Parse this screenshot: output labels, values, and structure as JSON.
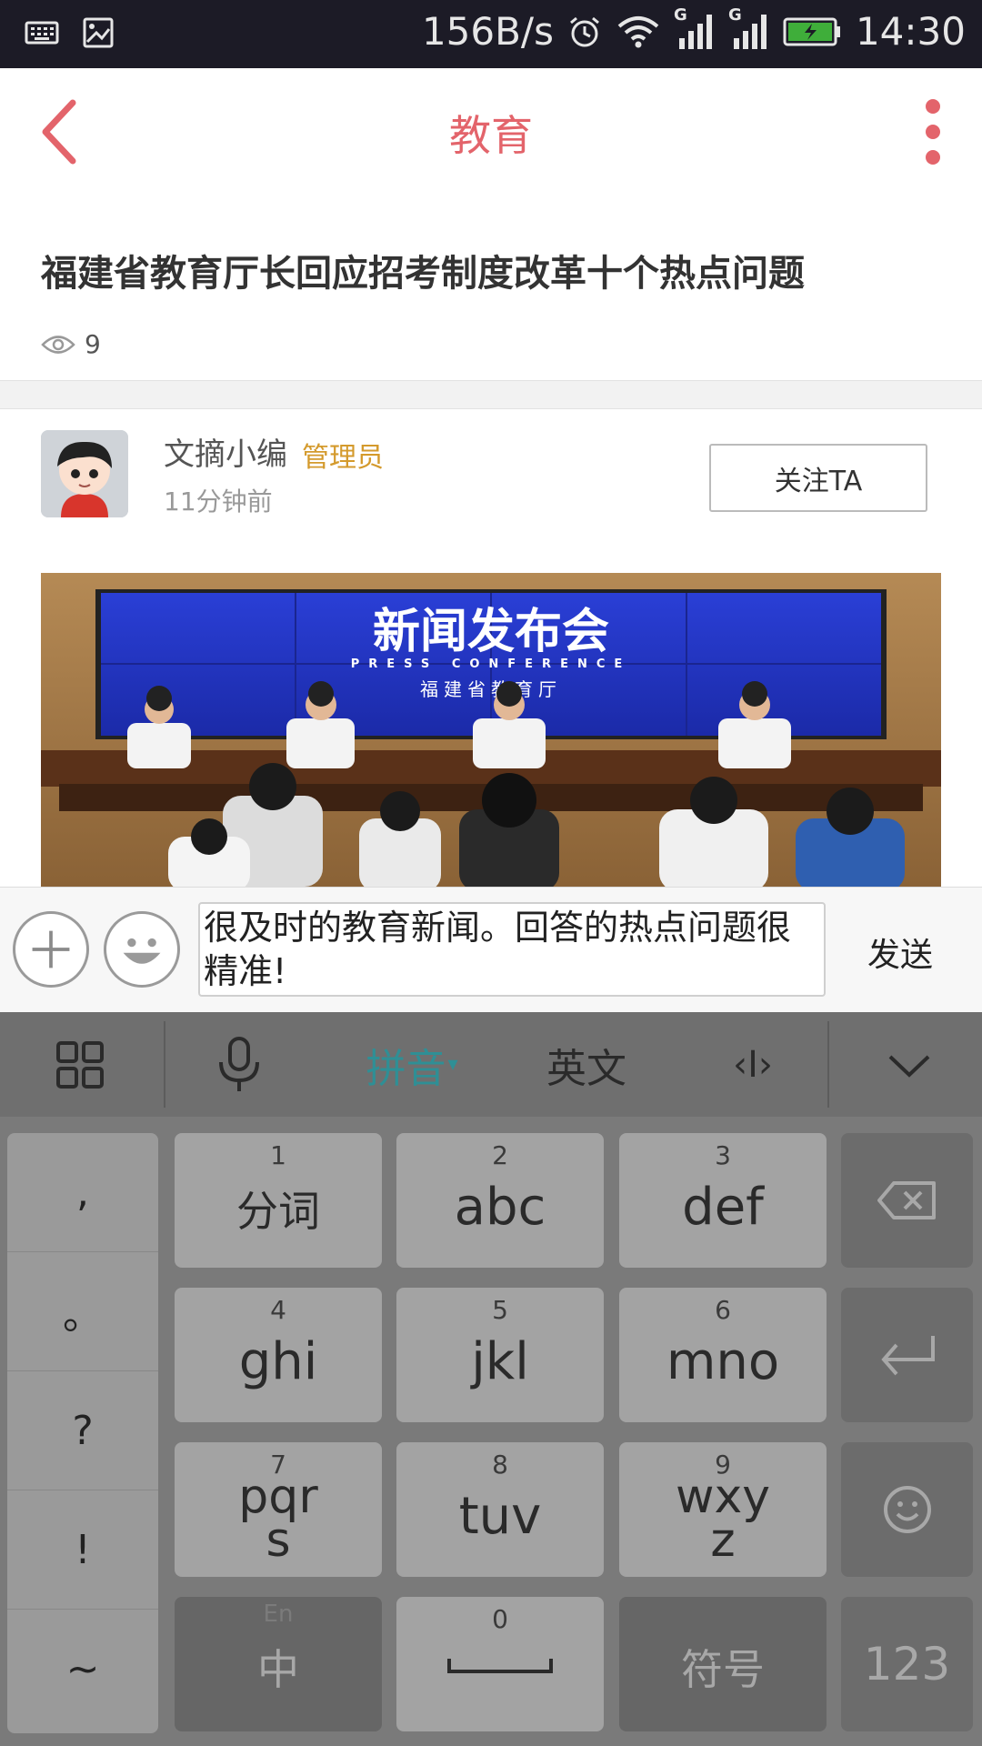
{
  "status_bar": {
    "left_icons": [
      "keyboard-icon",
      "image-icon"
    ],
    "speed": "156B/s",
    "right_icons": [
      "alarm-icon",
      "wifi-icon",
      "signal-icon",
      "signal-icon",
      "battery-charging-icon"
    ],
    "network_badge_1": "G",
    "network_badge_2": "G",
    "time": "14:30"
  },
  "header": {
    "title": "教育",
    "back_icon": "back-arrow-icon",
    "more_icon": "more-vertical-icon",
    "accent_color": "#e3646b"
  },
  "article": {
    "title": "福建省教育厅长回应招考制度改革十个热点问题",
    "view_count": "9",
    "views_icon": "eye-icon"
  },
  "author": {
    "name": "文摘小编",
    "role": "管理员",
    "time": "11分钟前",
    "follow_label": "关注TA"
  },
  "photo": {
    "banner_text": "新闻发布会",
    "banner_sub_en": "PRESS CONFERENCE",
    "banner_sub_cn": "福建省教育厅"
  },
  "comment_bar": {
    "input_value": "很及时的教育新闻。回答的热点问题很精准!",
    "send_label": "发送"
  },
  "keyboard": {
    "toolbar": {
      "pinyin": "拼音",
      "english": "英文",
      "cursor_glyph": "‹I›"
    },
    "punctuation": [
      ",",
      "。",
      "?",
      "!",
      "~"
    ],
    "keys": [
      {
        "num": "1",
        "label": "分词"
      },
      {
        "num": "2",
        "label": "abc"
      },
      {
        "num": "3",
        "label": "def"
      },
      {
        "num": "4",
        "label": "ghi"
      },
      {
        "num": "5",
        "label": "jkl"
      },
      {
        "num": "6",
        "label": "mno"
      },
      {
        "num": "7",
        "label_line1": "pqr",
        "label_line2": "s"
      },
      {
        "num": "8",
        "label": "tuv"
      },
      {
        "num": "9",
        "label_line1": "wxy",
        "label_line2": "z"
      }
    ],
    "bottom": {
      "zh_hint": "En",
      "zh_label": "中",
      "space_num": "0",
      "symbols": "符号",
      "numbers": "123"
    },
    "pinyin_color": "#2f8f95"
  }
}
